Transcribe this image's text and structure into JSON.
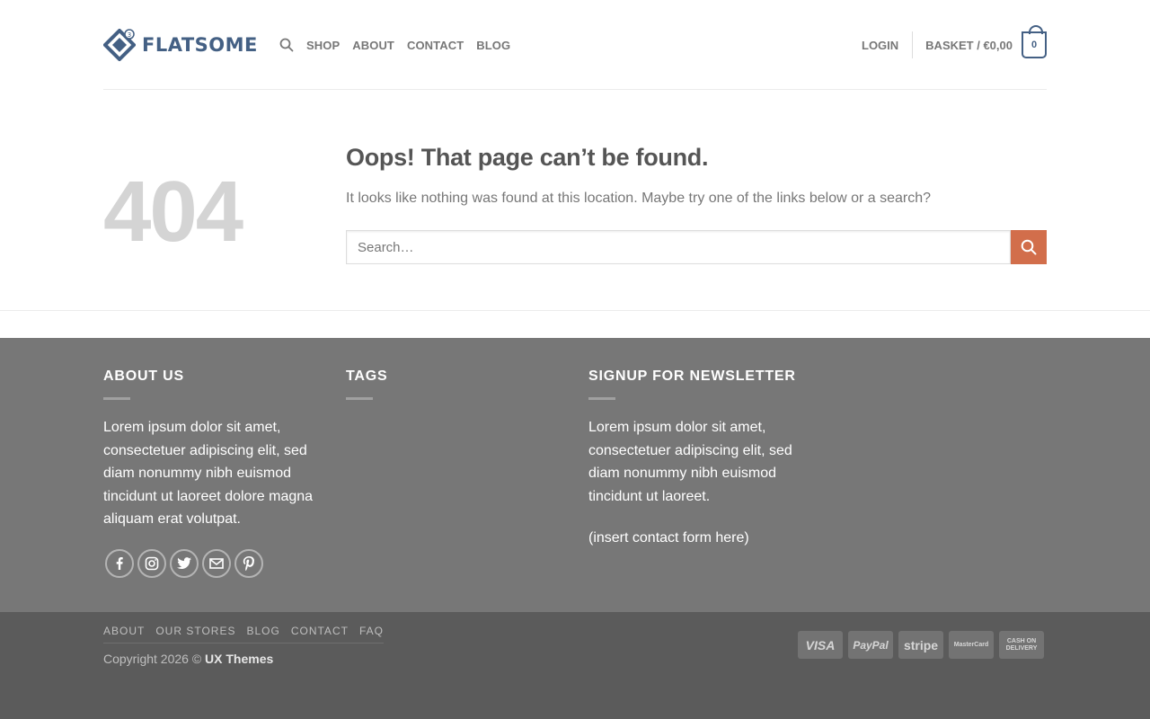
{
  "header": {
    "logo_text": "FLATSOME",
    "nav": [
      "Shop",
      "About",
      "Contact",
      "Blog"
    ],
    "login_label": "LOGIN",
    "basket_label": "BASKET / €0,00",
    "cart_count": "0",
    "accent_color": "#446084"
  },
  "main": {
    "error_code": "404",
    "title": "Oops! That page can’t be found.",
    "text": "It looks like nothing was found at this location. Maybe try one of the links below or a search?",
    "search_placeholder": "Search…",
    "search_button_color": "#d26e4b"
  },
  "footer": {
    "about": {
      "heading": "About us",
      "text": "Lorem ipsum dolor sit amet, consectetuer adipiscing elit, sed diam nonummy nibh euismod tincidunt ut laoreet dolore magna aliquam erat volutpat."
    },
    "tags": {
      "heading": "Tags"
    },
    "newsletter": {
      "heading": "Signup for newsletter",
      "text": "Lorem ipsum dolor sit amet, consectetuer adipiscing elit, sed diam nonummy nibh euismod tincidunt ut laoreet.",
      "form_note": "(insert contact form here)"
    },
    "socials": [
      "facebook-icon",
      "instagram-icon",
      "twitter-icon",
      "email-icon",
      "pinterest-icon"
    ],
    "bottom_nav": [
      "About",
      "Our Stores",
      "Blog",
      "Contact",
      "FAQ"
    ],
    "copyright_prefix": "Copyright 2026 ©",
    "copyright_brand": "UX Themes",
    "payments": [
      "VISA",
      "PayPal",
      "stripe",
      "MasterCard",
      "CASH ON DELIVERY"
    ]
  }
}
